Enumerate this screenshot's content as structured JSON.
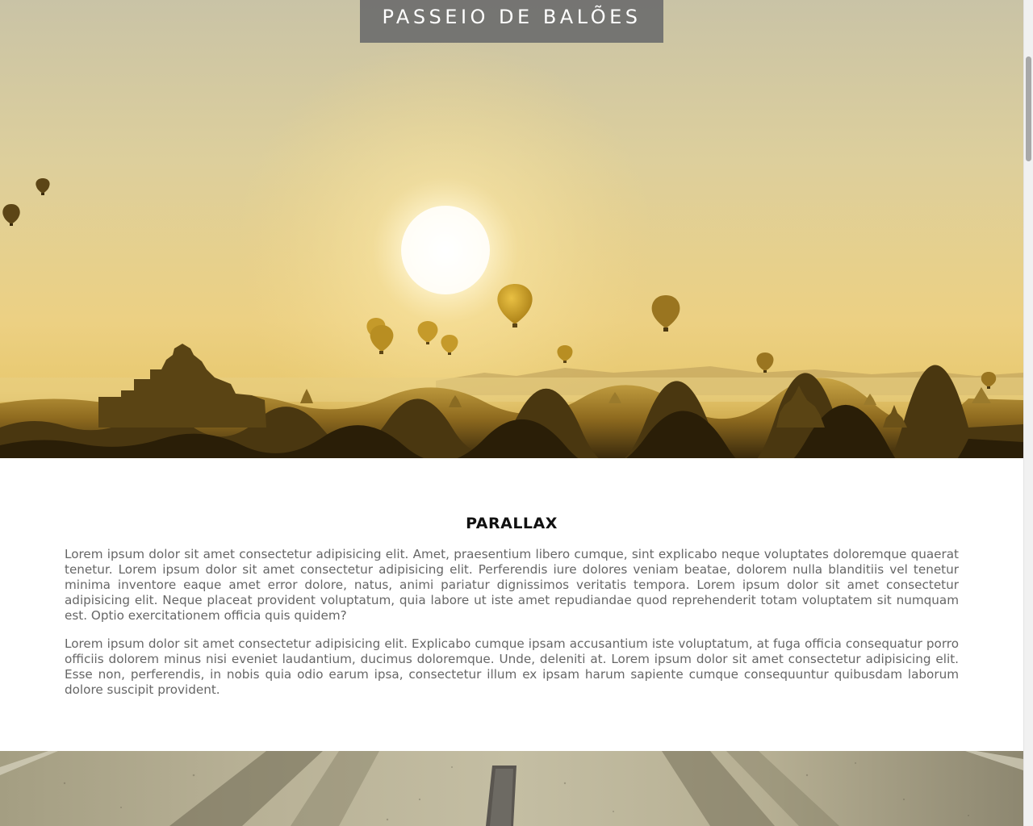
{
  "hero": {
    "title": "PASSEIO DE BALÕES",
    "image": "hot-air-balloons-over-temples-at-sunrise"
  },
  "section": {
    "heading": "PARALLAX",
    "paragraphs": [
      "Lorem ipsum dolor sit amet consectetur adipisicing elit. Amet, praesentium libero cumque, sint explicabo neque voluptates doloremque quaerat tenetur. Lorem ipsum dolor sit amet consectetur adipisicing elit. Perferendis iure dolores veniam beatae, dolorem nulla blanditiis vel tenetur minima inventore eaque amet error dolore, natus, animi pariatur dignissimos veritatis tempora. Lorem ipsum dolor sit amet consectetur adipisicing elit. Neque placeat provident voluptatum, quia labore ut iste amet repudiandae quod reprehenderit totam voluptatem sit numquam est. Optio exercitationem officia quis quidem?",
      "Lorem ipsum dolor sit amet consectetur adipisicing elit. Explicabo cumque ipsam accusantium iste voluptatum, at fuga officia consequatur porro officiis dolorem minus nisi eveniet laudantium, ducimus doloremque. Unde, deleniti at. Lorem ipsum dolor sit amet consectetur adipisicing elit. Esse non, perferendis, in nobis quia odio earum ipsa, consectetur illum ex ipsam harum sapiente cumque consequuntur quibusdam laborum dolore suscipit provident."
    ]
  },
  "road": {
    "image": "asphalt-road-background"
  },
  "colors": {
    "title_bg": "#6e6e6e",
    "title_text": "#ffffff",
    "heading": "#111111",
    "body_text": "#666666",
    "sky_top": "#cfc7a8",
    "sky_glow": "#f3d98a",
    "scrollbar_thumb": "#a8a8a8"
  }
}
